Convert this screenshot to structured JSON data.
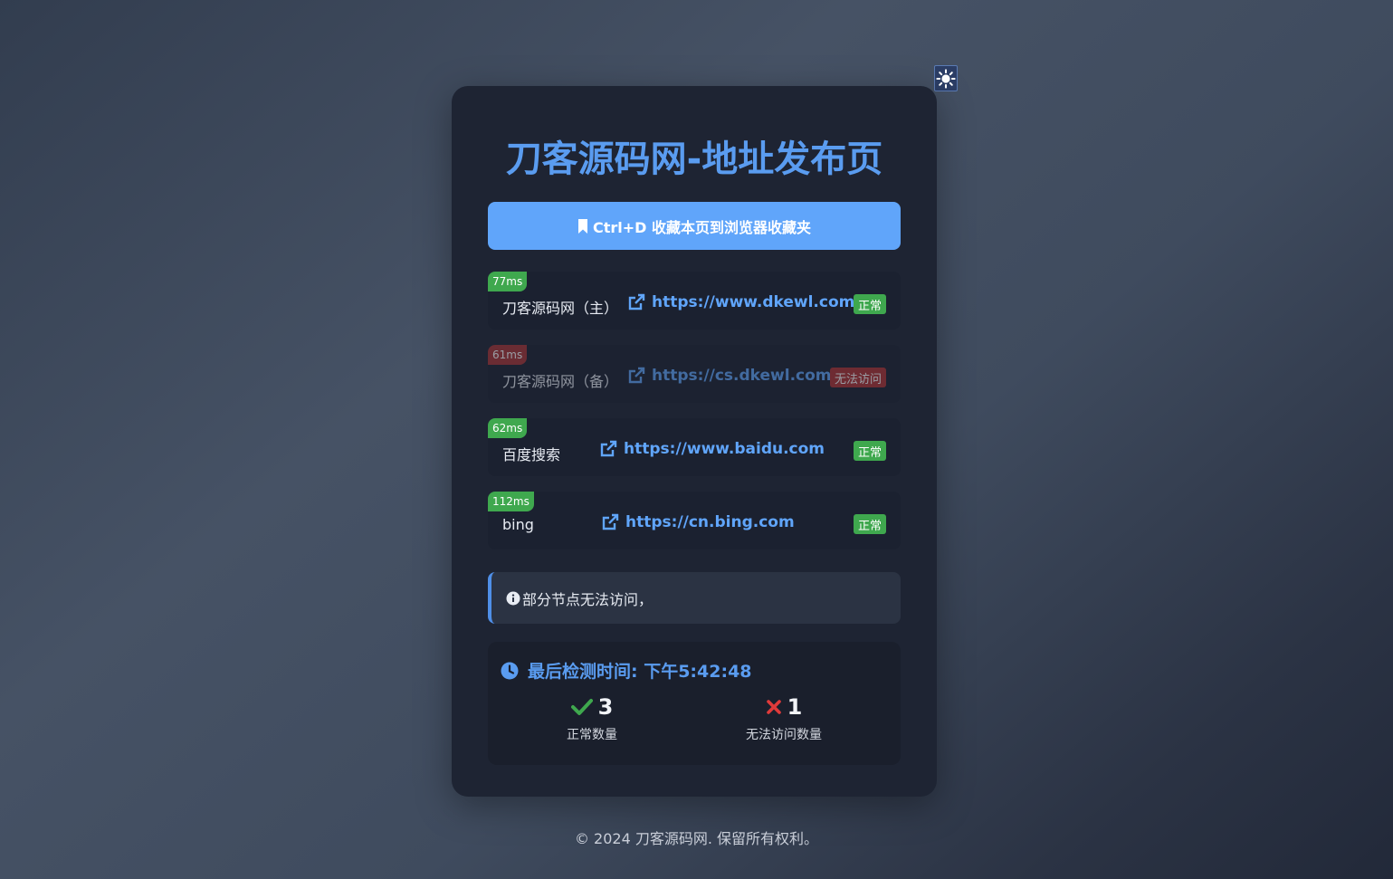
{
  "page": {
    "title": "刀客源码网-地址发布页",
    "bookmark_label": "Ctrl+D 收藏本页到浏览器收藏夹",
    "footer": "© 2024 刀客源码网. 保留所有权利。"
  },
  "theme_toggle": {
    "icon": "sun-icon"
  },
  "nodes": [
    {
      "latency": "77ms",
      "name": "刀客源码网（主）",
      "url": "https://www.dkewl.com",
      "status": "正常",
      "state": "ok"
    },
    {
      "latency": "61ms",
      "name": "刀客源码网（备）",
      "url": "https://cs.dkewl.com",
      "status": "无法访问",
      "state": "bad"
    },
    {
      "latency": "62ms",
      "name": "百度搜索",
      "url": "https://www.baidu.com",
      "status": "正常",
      "state": "ok"
    },
    {
      "latency": "112ms",
      "name": "bing",
      "url": "https://cn.bing.com",
      "status": "正常",
      "state": "ok"
    }
  ],
  "notice": {
    "text": "部分节点无法访问，"
  },
  "check": {
    "label": "最后检测时间: 下午5:42:48",
    "ok_count": "3",
    "ok_label": "正常数量",
    "bad_count": "1",
    "bad_label": "无法访问数量"
  },
  "colors": {
    "accent": "#60a5fa",
    "ok": "#3fa84e",
    "bad": "#b03232",
    "card": "#1e2433"
  }
}
